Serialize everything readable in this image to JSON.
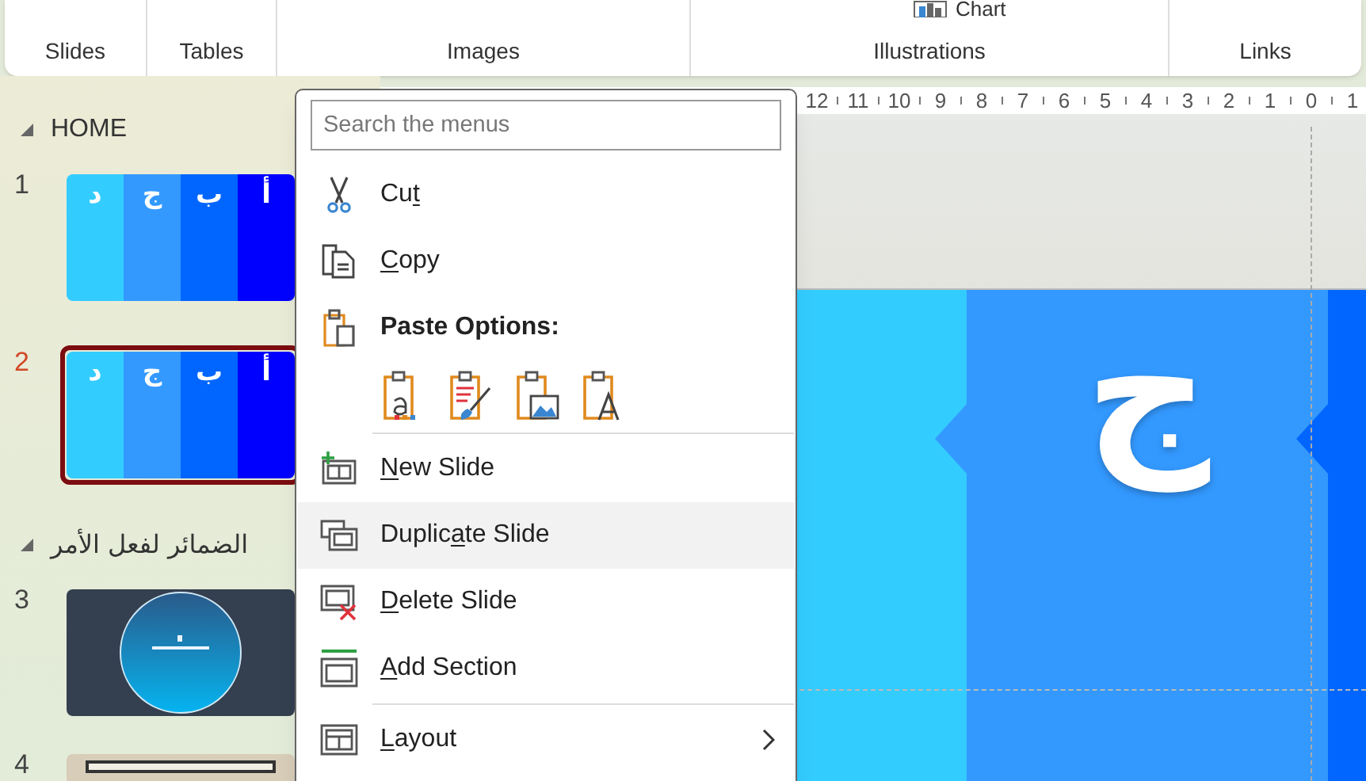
{
  "ribbon": {
    "command": "Chart",
    "groups": [
      "Slides",
      "Tables",
      "Images",
      "Illustrations",
      "Links"
    ]
  },
  "slides_pane": {
    "sections": [
      {
        "title": "HOME",
        "expanded": true,
        "slides": [
          {
            "number": "1",
            "selected": false,
            "kind": "letters",
            "letters": [
              "أ",
              "ب",
              "ج",
              "د"
            ]
          },
          {
            "number": "2",
            "selected": true,
            "kind": "letters",
            "letters": [
              "أ",
              "ب",
              "ج",
              "د"
            ]
          }
        ]
      },
      {
        "title": "الضمائر لفعل الأمر",
        "expanded": true,
        "slides": [
          {
            "number": "3",
            "selected": false,
            "kind": "title"
          },
          {
            "number": "4",
            "selected": false,
            "kind": "frame"
          }
        ]
      }
    ]
  },
  "ruler": [
    "12",
    "11",
    "10",
    "9",
    "8",
    "7",
    "6",
    "5",
    "4",
    "3",
    "2",
    "1",
    "0",
    "1"
  ],
  "slide_canvas": {
    "letter": "ج"
  },
  "context_menu": {
    "search": {
      "placeholder": "Search the menus"
    },
    "items": [
      {
        "kind": "cut",
        "label_parts": {
          "before": "Cu",
          "key": "t"
        },
        "selected": false
      },
      {
        "kind": "copy",
        "label_parts": {
          "key": "C",
          "after": "opy"
        },
        "selected": false
      },
      {
        "kind": "paste_heading",
        "label": "Paste Options:"
      },
      {
        "kind": "paste_buttons"
      },
      {
        "kind": "separator"
      },
      {
        "kind": "new_slide",
        "label_parts": {
          "key": "N",
          "after": "ew Slide"
        },
        "selected": false
      },
      {
        "kind": "duplicate",
        "label_parts": {
          "before": "Duplic",
          "key": "a",
          "after": "te Slide"
        },
        "selected": true
      },
      {
        "kind": "delete",
        "label_parts": {
          "key": "D",
          "after": "elete Slide"
        },
        "selected": false
      },
      {
        "kind": "section",
        "label_parts": {
          "key": "A",
          "after": "dd Section"
        },
        "selected": false
      },
      {
        "kind": "separator"
      },
      {
        "kind": "layout",
        "label_parts": {
          "key": "L",
          "after": "ayout"
        },
        "selected": false,
        "submenu": true
      }
    ]
  }
}
